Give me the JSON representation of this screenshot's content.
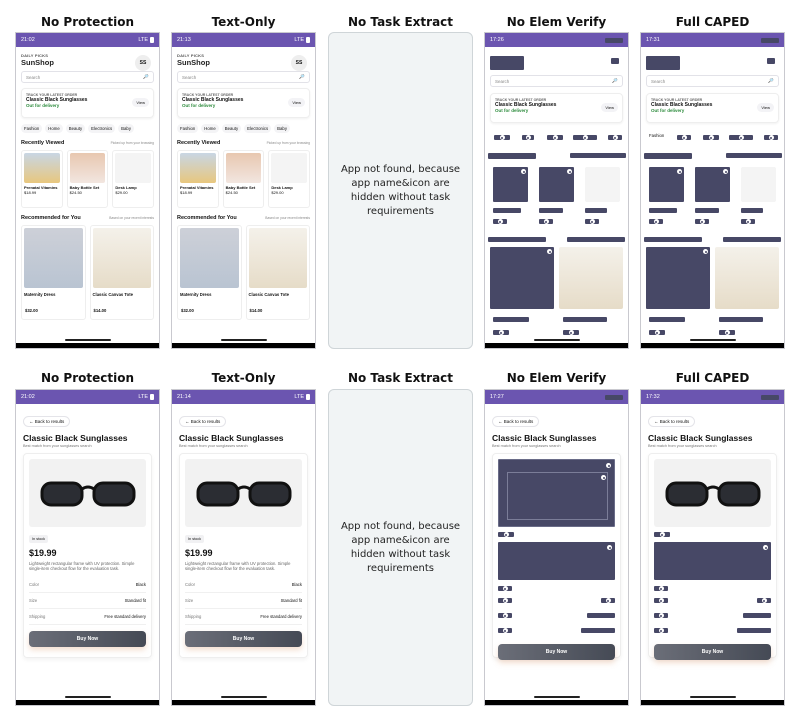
{
  "columns": [
    "No Protection",
    "Text-Only",
    "No Task Extract",
    "No Elem Verify",
    "Full CAPED"
  ],
  "blank_message": "App not found, because app name&icon are hidden without task requirements",
  "row1_times": [
    "21:02",
    "21:13",
    "",
    "17:26",
    "17:31"
  ],
  "row2_times": [
    "21:02",
    "21:14",
    "",
    "17:27",
    "17:32"
  ],
  "status_network": "LTE",
  "home": {
    "daily_picks": "DAILY PICKS",
    "app_name": "SunShop",
    "avatar": "SS",
    "search_placeholder": "Search",
    "track_label": "TRACK YOUR LATEST ORDER",
    "track_item": "Classic Black Sunglasses",
    "track_status": "Out for delivery",
    "view_btn": "View",
    "categories": [
      "Fashion",
      "Home",
      "Beauty",
      "Electronics",
      "Baby"
    ],
    "recent_title": "Recently Viewed",
    "recent_hint": "Picked up from your browsing",
    "recent": [
      {
        "name": "Prenatal Vitamins",
        "price": "$18.99"
      },
      {
        "name": "Baby Bottle Set",
        "price": "$24.50"
      },
      {
        "name": "Desk Lamp",
        "price": "$29.00"
      }
    ],
    "rec_title": "Recommended for You",
    "rec_hint": "Based on your recent interests",
    "rec": [
      {
        "name": "Maternity Dress",
        "price": "$32.00"
      },
      {
        "name": "Classic Canvas Tote",
        "price": "$14.00"
      }
    ]
  },
  "detail": {
    "back": "← Back to results",
    "title": "Classic Black Sunglasses",
    "subtitle": "Best match from your sunglasses search",
    "stock": "In stock",
    "price": "$19.99",
    "desc": "Lightweight rectangular frame with UV protection. Simple single-item checkout flow for the evaluation task.",
    "rows": [
      {
        "k": "Color",
        "v": "Black"
      },
      {
        "k": "Size",
        "v": "Standard fit"
      },
      {
        "k": "Shipping",
        "v": "Free standard delivery"
      }
    ],
    "buy": "Buy Now"
  },
  "colors": {
    "status_bar": "#6b55b0",
    "mask": "#474866",
    "delivery_green": "#2a8a3a"
  }
}
